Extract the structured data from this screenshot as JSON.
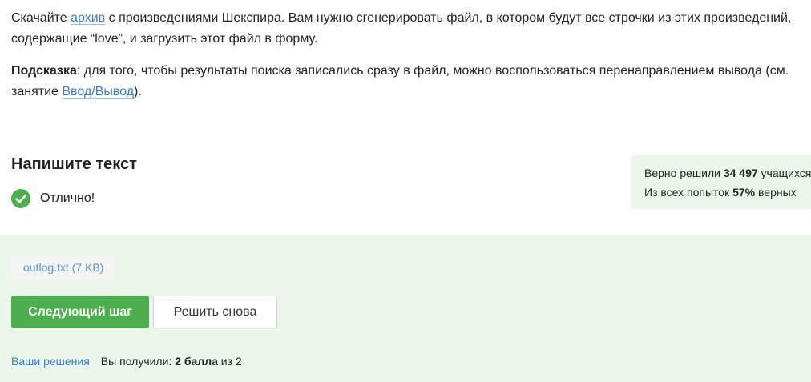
{
  "task": {
    "p1": {
      "before_link": "Скачайте ",
      "link": "архив",
      "after_link": " с произведениями Шекспира. Вам нужно сгенерировать файл, в котором будут все строчки из этих произведений, содержащие “love”, и загрузить этот файл в форму."
    },
    "p2": {
      "bold": "Подсказка",
      "before_link": ": для того, чтобы результаты поиска записались сразу в файл, можно воспользоваться перенаправлением вывода (см. занятие ",
      "link": "Ввод/Вывод",
      "after_link": ")."
    }
  },
  "answer": {
    "title": "Напишите текст",
    "status_text": "Отлично!",
    "status_icon": "check-circle-icon",
    "status_color": "#4cae4f"
  },
  "stats": {
    "line1_prefix": "Верно решили ",
    "line1_value": "34 497",
    "line1_suffix": " учащихся",
    "line2_prefix": "Из всех попыток ",
    "line2_value": "57%",
    "line2_suffix": " верных"
  },
  "submission": {
    "file_chip": "outlog.txt (7 KB)",
    "next_button": "Следующий шаг",
    "retry_button": "Решить снова",
    "solutions_link": "Ваши решения",
    "score_prefix": "Вы получили: ",
    "score_value": "2 балла",
    "score_suffix": " из 2"
  },
  "colors": {
    "accent_green": "#4cae4f",
    "panel_bg": "#e9f6e9",
    "link_blue": "#3a7bd5"
  }
}
